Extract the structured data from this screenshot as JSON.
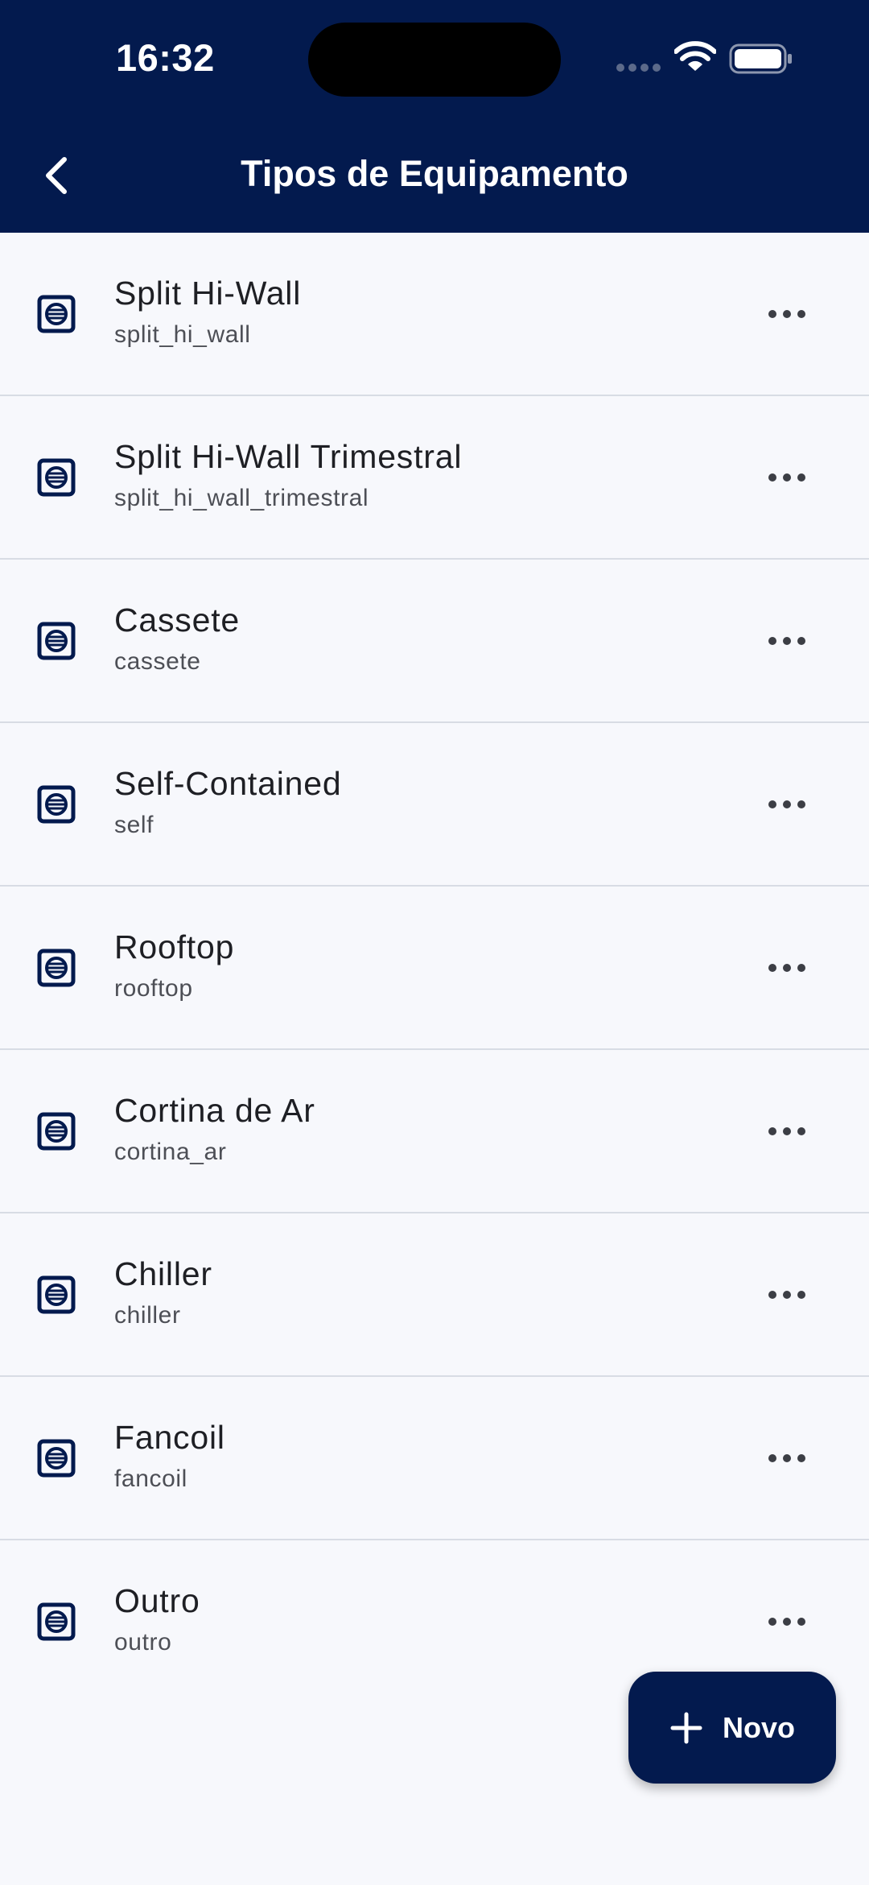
{
  "status_bar": {
    "time": "16:32"
  },
  "header": {
    "title": "Tipos de Equipamento"
  },
  "items": [
    {
      "title": "Split Hi-Wall",
      "subtitle": "split_hi_wall"
    },
    {
      "title": "Split Hi-Wall Trimestral",
      "subtitle": "split_hi_wall_trimestral"
    },
    {
      "title": "Cassete",
      "subtitle": "cassete"
    },
    {
      "title": "Self-Contained",
      "subtitle": "self"
    },
    {
      "title": "Rooftop",
      "subtitle": "rooftop"
    },
    {
      "title": "Cortina de Ar",
      "subtitle": "cortina_ar"
    },
    {
      "title": "Chiller",
      "subtitle": "chiller"
    },
    {
      "title": "Fancoil",
      "subtitle": "fancoil"
    },
    {
      "title": "Outro",
      "subtitle": "outro"
    }
  ],
  "fab": {
    "label": "Novo"
  },
  "colors": {
    "primary": "#031a4e",
    "background": "#f7f8fc",
    "divider": "#d8dce4"
  }
}
